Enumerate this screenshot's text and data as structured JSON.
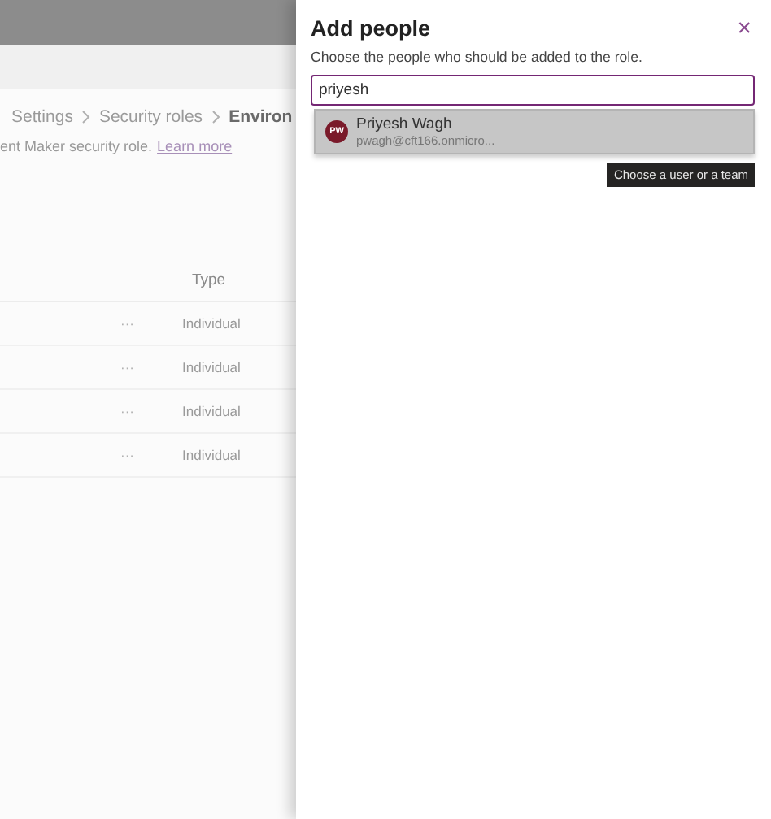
{
  "background": {
    "breadcrumb": [
      {
        "label": "Settings",
        "current": false
      },
      {
        "label": "Security roles",
        "current": false
      },
      {
        "label": "Environ",
        "current": true
      }
    ],
    "description": {
      "text": "ent Maker security role.",
      "link": "Learn more"
    },
    "table": {
      "columns": [
        "Type"
      ],
      "rows": [
        {
          "more": "···",
          "type": "Individual"
        },
        {
          "more": "···",
          "type": "Individual"
        },
        {
          "more": "···",
          "type": "Individual"
        },
        {
          "more": "···",
          "type": "Individual"
        }
      ]
    }
  },
  "panel": {
    "title": "Add people",
    "close": "×",
    "subtitle": "Choose the people who should be added to the role.",
    "search": {
      "value": "priyesh"
    },
    "suggestions": [
      {
        "initials": "PW",
        "name": "Priyesh Wagh",
        "email": "pwagh@cft166.onmicro...",
        "color": "#7a1a2a"
      }
    ],
    "tooltip": "Choose a user or a team"
  }
}
